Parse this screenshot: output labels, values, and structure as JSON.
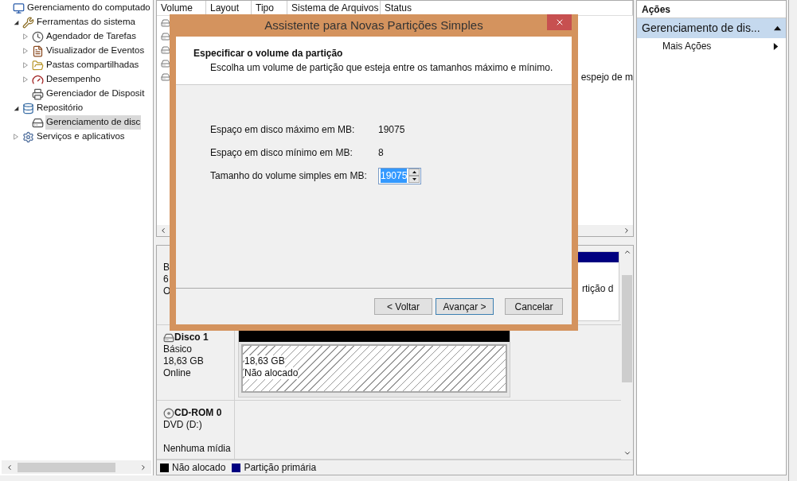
{
  "tree": [
    {
      "label": "Gerenciamento do computado",
      "selected": false,
      "children": [
        {
          "label": "Ferramentas do sistema",
          "expanded": true,
          "selected": false,
          "children": [
            {
              "label": "Agendador de Tarefas",
              "expanded": false,
              "selected": false
            },
            {
              "label": "Visualizador de Eventos",
              "expanded": false,
              "selected": false
            },
            {
              "label": "Pastas compartilhadas",
              "expanded": false,
              "selected": false
            },
            {
              "label": "Desempenho",
              "expanded": false,
              "selected": false
            },
            {
              "label": "Gerenciador de Disposit",
              "selected": false
            }
          ]
        },
        {
          "label": "Repositório",
          "expanded": true,
          "selected": false,
          "children": [
            {
              "label": "Gerenciamento de disc",
              "selected": true
            }
          ]
        },
        {
          "label": "Serviços e aplicativos",
          "expanded": false,
          "selected": false
        }
      ]
    }
  ],
  "volume_table": {
    "columns": [
      "Volume",
      "Layout",
      "Tipo",
      "Sistema de Arquivos",
      "Status"
    ],
    "rows": [
      {},
      {},
      {},
      {},
      {
        "status": "espejo de m"
      }
    ]
  },
  "disk_0": {
    "line_1": "B",
    "line_2": "6",
    "line_3": "O",
    "partition_text": "rtição d"
  },
  "disks": [
    {
      "name": "Disco 1",
      "kind": "disk",
      "lines": [
        "Básico",
        "18,63 GB",
        "Online"
      ],
      "partition": {
        "size": "18,63 GB",
        "label": "Não alocado"
      }
    },
    {
      "name": "CD-ROM 0",
      "kind": "cdrom",
      "lines": [
        "DVD (D:)",
        "Nenhuma mídia"
      ]
    }
  ],
  "legend": [
    {
      "label": "Não alocado",
      "color": "#000000"
    },
    {
      "label": "Partição primária",
      "color": "#000080"
    }
  ],
  "actions": {
    "title": "Ações",
    "items": [
      {
        "label": "Gerenciamento de dis...",
        "kind": "section"
      },
      {
        "label": "Mais Ações",
        "kind": "submenu"
      }
    ]
  },
  "dialog": {
    "title": "Assistente para Novas Partições Simples",
    "heading": "Especificar o volume da partição",
    "subheading": "Escolha um volume de partição que esteja entre os tamanhos máximo e mínimo.",
    "fields": [
      {
        "label": "Espaço em disco máximo em MB:",
        "value": "19075",
        "kind": "text"
      },
      {
        "label": "Espaço em disco mínimo em MB:",
        "value": "8",
        "kind": "text"
      },
      {
        "label": "Tamanho do volume simples em MB:",
        "value": "19075",
        "kind": "spinner"
      }
    ],
    "buttons": [
      {
        "label": "< Voltar",
        "default": false
      },
      {
        "label": "Avançar >",
        "default": true
      },
      {
        "label": "Cancelar",
        "default": false
      }
    ]
  }
}
